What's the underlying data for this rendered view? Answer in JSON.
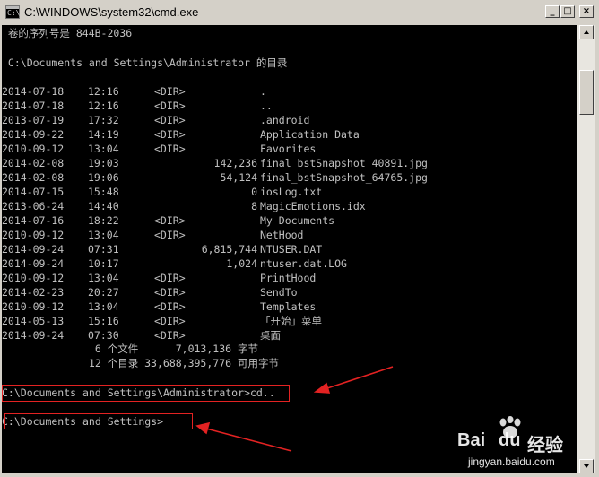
{
  "window": {
    "title": "C:\\WINDOWS\\system32\\cmd.exe",
    "minimize": "_",
    "maximize": "□",
    "close": "×"
  },
  "console": {
    "serial_line": " 卷的序列号是 844B-2036",
    "header_line": " C:\\Documents and Settings\\Administrator 的目录",
    "entries": [
      {
        "date": "2014-07-18",
        "time": "12:16",
        "dir": "<DIR>",
        "size": "",
        "name": "."
      },
      {
        "date": "2014-07-18",
        "time": "12:16",
        "dir": "<DIR>",
        "size": "",
        "name": ".."
      },
      {
        "date": "2013-07-19",
        "time": "17:32",
        "dir": "<DIR>",
        "size": "",
        "name": ".android"
      },
      {
        "date": "2014-09-22",
        "time": "14:19",
        "dir": "<DIR>",
        "size": "",
        "name": "Application Data"
      },
      {
        "date": "2010-09-12",
        "time": "13:04",
        "dir": "<DIR>",
        "size": "",
        "name": "Favorites"
      },
      {
        "date": "2014-02-08",
        "time": "19:03",
        "dir": "",
        "size": "142,236",
        "name": "final_bstSnapshot_40891.jpg"
      },
      {
        "date": "2014-02-08",
        "time": "19:06",
        "dir": "",
        "size": "54,124",
        "name": "final_bstSnapshot_64765.jpg"
      },
      {
        "date": "2014-07-15",
        "time": "15:48",
        "dir": "",
        "size": "0",
        "name": "iosLog.txt"
      },
      {
        "date": "2013-06-24",
        "time": "14:40",
        "dir": "",
        "size": "8",
        "name": "MagicEmotions.idx"
      },
      {
        "date": "2014-07-16",
        "time": "18:22",
        "dir": "<DIR>",
        "size": "",
        "name": "My Documents"
      },
      {
        "date": "2010-09-12",
        "time": "13:04",
        "dir": "<DIR>",
        "size": "",
        "name": "NetHood"
      },
      {
        "date": "2014-09-24",
        "time": "07:31",
        "dir": "",
        "size": "6,815,744",
        "name": "NTUSER.DAT"
      },
      {
        "date": "2014-09-24",
        "time": "10:17",
        "dir": "",
        "size": "1,024",
        "name": "ntuser.dat.LOG"
      },
      {
        "date": "2010-09-12",
        "time": "13:04",
        "dir": "<DIR>",
        "size": "",
        "name": "PrintHood"
      },
      {
        "date": "2014-02-23",
        "time": "20:27",
        "dir": "<DIR>",
        "size": "",
        "name": "SendTo"
      },
      {
        "date": "2010-09-12",
        "time": "13:04",
        "dir": "<DIR>",
        "size": "",
        "name": "Templates"
      },
      {
        "date": "2014-05-13",
        "time": "15:16",
        "dir": "<DIR>",
        "size": "",
        "name": "「开始」菜单"
      },
      {
        "date": "2014-09-24",
        "time": "07:30",
        "dir": "<DIR>",
        "size": "",
        "name": "桌面"
      }
    ],
    "summary_files": "               6 个文件      7,013,136 字节",
    "summary_dirs": "              12 个目录 33,688,395,776 可用字节",
    "command_line": "C:\\Documents and Settings\\Administrator>cd..",
    "prompt_line": "C:\\Documents and Settings>"
  },
  "colors": {
    "console_bg": "#000000",
    "console_text": "#c0c0c0",
    "annotation": "#e32222",
    "chrome": "#d4d0c8"
  },
  "watermark": {
    "brand": "Bai",
    "paw": "du",
    "word": "经验",
    "url": "jingyan.baidu.com"
  }
}
